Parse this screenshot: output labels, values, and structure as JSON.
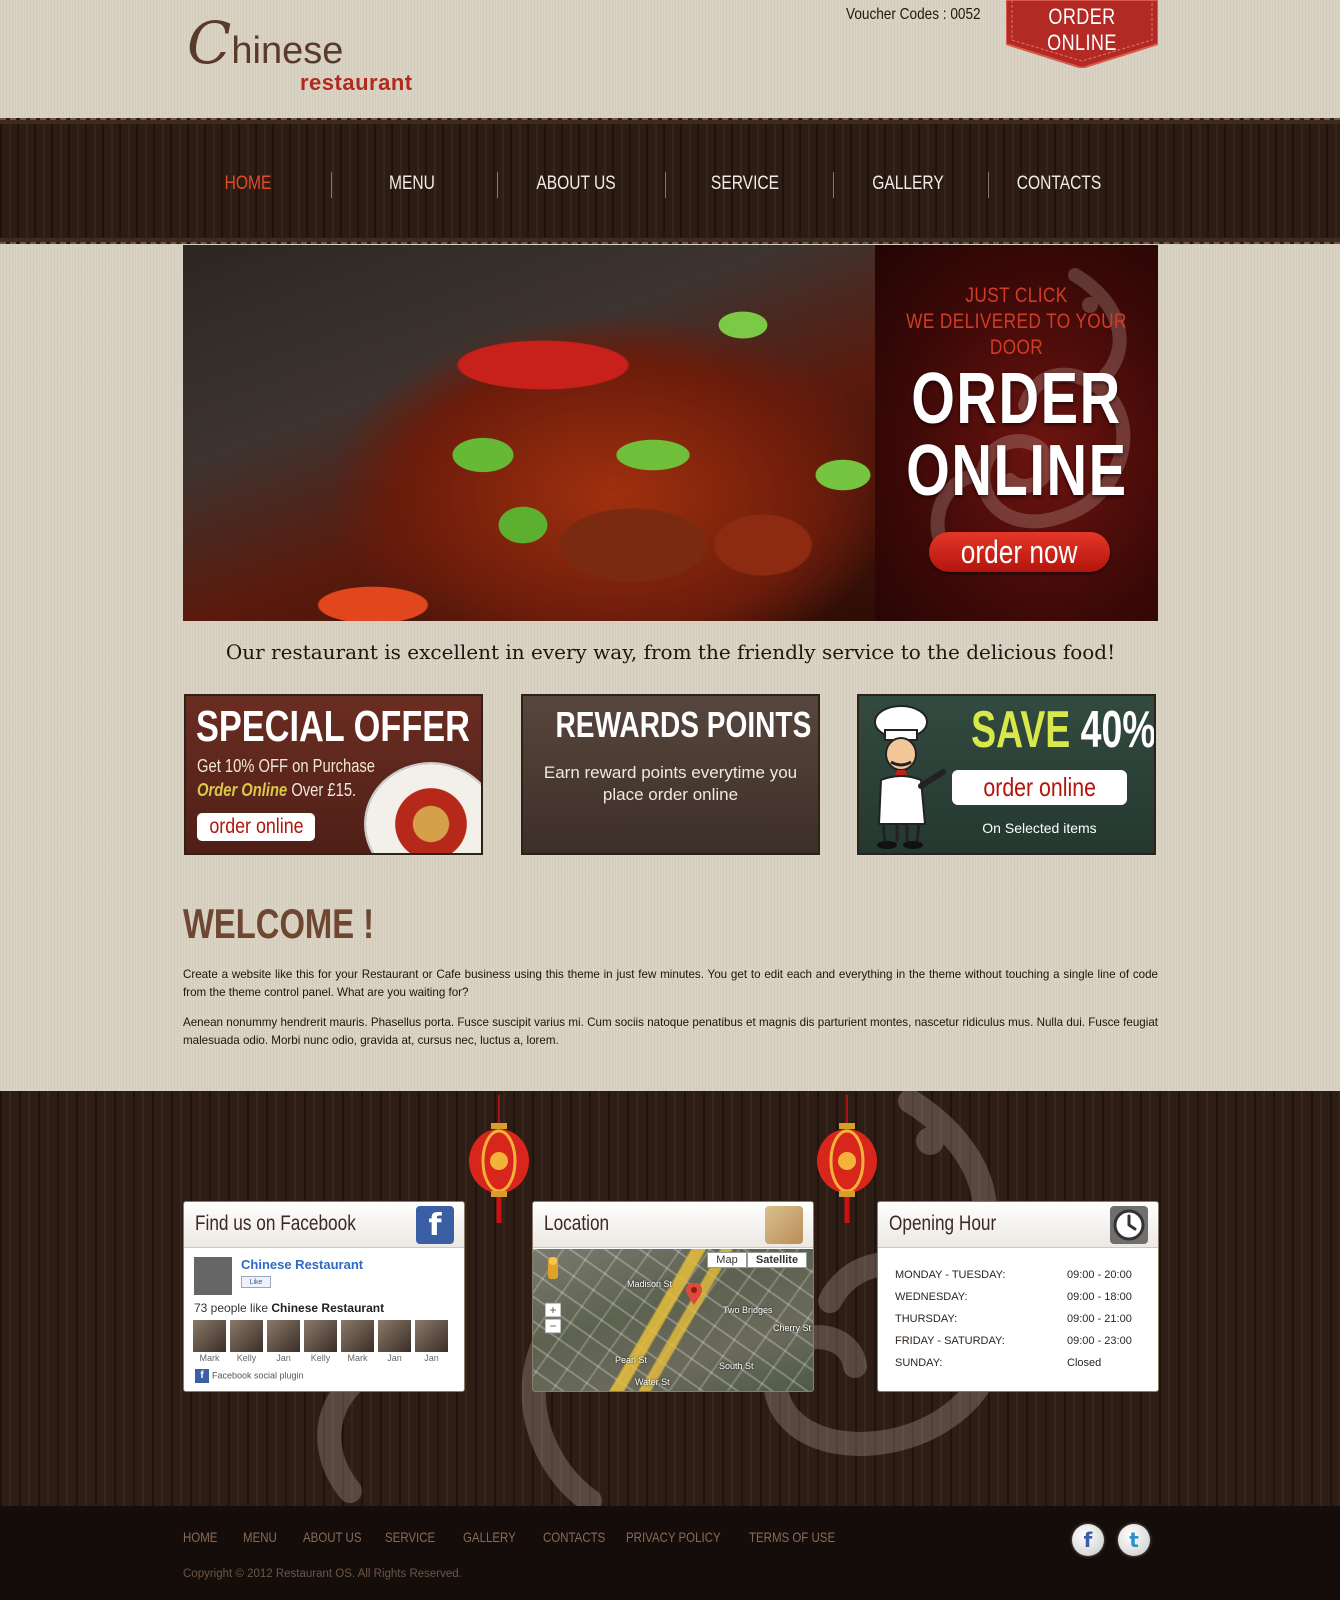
{
  "header": {
    "logo_main": "C",
    "logo_main_rest": "hinese",
    "logo_sub": "restaurant",
    "voucher": "Voucher Codes : 0052",
    "order_badge": "ORDER ONLINE"
  },
  "nav": {
    "items": [
      {
        "label": "HOME",
        "active": true
      },
      {
        "label": "MENU"
      },
      {
        "label": "ABOUT US"
      },
      {
        "label": "SERVICE"
      },
      {
        "label": "GALLERY"
      },
      {
        "label": "CONTACTS"
      }
    ]
  },
  "hero": {
    "line1": "JUST CLICK",
    "line2": "WE DELIVERED TO YOUR DOOR",
    "big1": "ORDER",
    "big2": "ONLINE",
    "button": "order now"
  },
  "tagline": "Our restaurant is excellent in every way, from the friendly service to the delicious food!",
  "promos": {
    "special": {
      "title": "SPECIAL OFFER",
      "line1": "Get 10% OFF on Purchase",
      "line2_em": "Order Online",
      "line2_rest": " Over £15.",
      "button": "order online"
    },
    "rewards": {
      "title": "REWARDS POINTS",
      "text": "Earn reward points everytime you place order online"
    },
    "save": {
      "title_a": "SAVE",
      "title_b": " 40%",
      "button": "order online",
      "sub": "On Selected items"
    }
  },
  "welcome": {
    "title": "WELCOME !",
    "p1": "Create a website like this for your Restaurant or Cafe business using this theme in just few minutes. You  get to edit each and everything in the theme without touching a single line of code from the theme control panel. What are you waiting for?",
    "p2": "Aenean nonummy hendrerit mauris. Phasellus porta. Fusce suscipit varius mi. Cum sociis natoque penatibus et magnis dis parturient montes, nascetur ridiculus mus. Nulla dui. Fusce feugiat malesuada odio. Morbi nunc odio, gravida at, cursus nec, luctus a, lorem."
  },
  "facebook": {
    "title": "Find us on Facebook",
    "icon": "facebook-icon",
    "page_name": "Chinese Restaurant",
    "like_label": "Like",
    "count_prefix": "73 people like ",
    "count_name": "Chinese Restaurant",
    "faces": [
      "Mark",
      "Kelly",
      "Jan",
      "Kelly",
      "Mark",
      "Jan",
      "Jan"
    ],
    "plugin": "Facebook social plugin"
  },
  "location": {
    "title": "Location",
    "icon": "map-icon",
    "map_btn": "Map",
    "satellite_btn": "Satellite",
    "labels": [
      "Madison St",
      "Two Bridges",
      "Cherry St",
      "South St",
      "Water St",
      "Pearl St"
    ]
  },
  "hours": {
    "title": "Opening Hour",
    "icon": "clock-icon",
    "rows": [
      {
        "day": "MONDAY - TUESDAY:",
        "time": "09:00 - 20:00"
      },
      {
        "day": "WEDNESDAY:",
        "time": "09:00 - 18:00"
      },
      {
        "day": "THURSDAY:",
        "time": "09:00 - 21:00"
      },
      {
        "day": "FRIDAY - SATURDAY:",
        "time": "09:00 - 23:00"
      },
      {
        "day": "SUNDAY:",
        "time": "Closed"
      }
    ]
  },
  "footer": {
    "links": [
      "HOME",
      "MENU",
      "ABOUT US",
      "SERVICE",
      "GALLERY",
      "CONTACTS",
      "PRIVACY POLICY",
      "TERMS OF USE"
    ],
    "copyright": "Copyright © 2012 Restaurant OS. All Rights Reserved.",
    "social": [
      "facebook-icon",
      "twitter-icon"
    ]
  },
  "colors": {
    "accent_red": "#b3140c",
    "nav_active": "#e44b2a",
    "wood_dark": "#2c1c14",
    "canvas": "#d9d2c2"
  }
}
